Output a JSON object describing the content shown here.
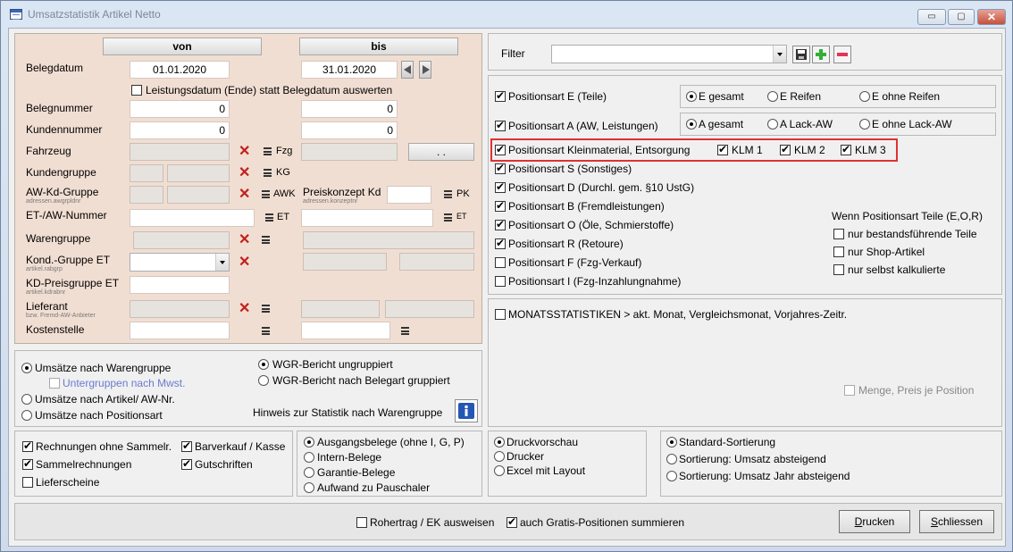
{
  "window": {
    "title": "Umsatzstatistik Artikel Netto",
    "controls": {
      "minimize": "▭",
      "maximize": "▢",
      "close": "✕"
    }
  },
  "criteria": {
    "col_von": "von",
    "col_bis": "bis",
    "belegdatum": {
      "label": "Belegdatum",
      "von": "01.01.2020",
      "bis": "31.01.2020"
    },
    "leistungsdatum_label": "Leistungsdatum (Ende) statt Belegdatum auswerten",
    "belegnummer": {
      "label": "Belegnummer",
      "von": "0",
      "bis": "0"
    },
    "kundennummer": {
      "label": "Kundennummer",
      "von": "0",
      "bis": "0"
    },
    "fahrzeug": {
      "label": "Fahrzeug",
      "tag": "Fzg",
      "button": ". ."
    },
    "kundengruppe": {
      "label": "Kundengruppe",
      "tag": "KG"
    },
    "aw_kd_gruppe": {
      "label": "AW-Kd-Gruppe",
      "sub": "adressen.awgrpldnr",
      "tag": "AWK"
    },
    "preiskonzept": {
      "label": "Preiskonzept Kd",
      "sub": "adressen.konzeptnr",
      "tag": "PK"
    },
    "et_aw_nummer": {
      "label": "ET-/AW-Nummer",
      "tag": "ET",
      "tag2": "ET"
    },
    "warengruppe": {
      "label": "Warengruppe"
    },
    "kond_gruppe": {
      "label": "Kond.-Gruppe ET",
      "sub": "artikel.rabgrp"
    },
    "kd_preisgruppe": {
      "label": "KD-Preisgruppe ET",
      "sub": "artikel.kdrabnr"
    },
    "lieferant": {
      "label": "Lieferant",
      "sub": "bzw. Fremd-AW-Anbieter"
    },
    "kostenstelle": {
      "label": "Kostenstelle"
    }
  },
  "filter": {
    "label": "Filter",
    "value": ""
  },
  "positions": {
    "e": {
      "label": "Positionsart E (Teile)",
      "checked": true
    },
    "e_opts": [
      "E gesamt",
      "E Reifen",
      "E ohne Reifen"
    ],
    "a": {
      "label": "Positionsart A (AW, Leistungen)",
      "checked": true
    },
    "a_opts": [
      "A gesamt",
      "A Lack-AW",
      "E ohne Lack-AW"
    ],
    "klein": {
      "label": "Positionsart Kleinmaterial, Entsorgung",
      "checked": true
    },
    "klm": [
      "KLM 1",
      "KLM 2",
      "KLM 3"
    ],
    "list": [
      {
        "label": "Positionsart S (Sonstiges)",
        "checked": true
      },
      {
        "label": "Positionsart D (Durchl. gem. §10 UstG)",
        "checked": true
      },
      {
        "label": "Positionsart B (Fremdleistungen)",
        "checked": true
      },
      {
        "label": "Positionsart O (Öle, Schmierstoffe)",
        "checked": true
      },
      {
        "label": "Positionsart R (Retoure)",
        "checked": true
      },
      {
        "label": "Positionsart F (Fzg-Verkauf)",
        "checked": false
      },
      {
        "label": "Positionsart I (Fzg-Inzahlungnahme)",
        "checked": false
      }
    ],
    "teile_head": "Wenn Positionsart Teile (E,O,R)",
    "teile_opts": [
      "nur bestandsführende Teile",
      "nur Shop-Artikel",
      "nur selbst kalkulierte"
    ]
  },
  "monat": {
    "label": "MONATSSTATISTIKEN > akt. Monat, Vergleichsmonat, Vorjahres-Zeitr.",
    "menge": "Menge, Preis je Position"
  },
  "umsatz": {
    "warengruppe": "Umsätze nach Warengruppe",
    "untergruppen": "Untergruppen nach Mwst.",
    "artikel": "Umsätze nach Artikel/ AW-Nr.",
    "positionsart": "Umsätze nach Positionsart",
    "wgr_ungrupp": "WGR-Bericht ungruppiert",
    "wgr_belegart": "WGR-Bericht nach Belegart gruppiert",
    "hinweis": "Hinweis zur Statistik nach Warengruppe"
  },
  "belegarten": {
    "rechnungen": "Rechnungen ohne Sammelr.",
    "barverkauf": "Barverkauf / Kasse",
    "sammel": "Sammelrechnungen",
    "gutschriften": "Gutschriften",
    "lieferscheine": "Lieferscheine"
  },
  "belegtyp": [
    "Ausgangsbelege (ohne I, G, P)",
    "Intern-Belege",
    "Garantie-Belege",
    "Aufwand zu Pauschaler"
  ],
  "ausgabe": [
    "Druckvorschau",
    "Drucker",
    "Excel mit Layout"
  ],
  "sortierung": [
    "Standard-Sortierung",
    "Sortierung: Umsatz absteigend",
    "Sortierung: Umsatz Jahr absteigend"
  ],
  "footer": {
    "rohertrag": "Rohertrag / EK ausweisen",
    "gratis": "auch Gratis-Positionen summieren",
    "drucken_u": "D",
    "drucken_rest": "rucken",
    "schliessen_u": "S",
    "schliessen_rest": "chliessen"
  },
  "colors": {
    "accent": "#e03131",
    "panel_tan": "#f1ded2",
    "x_red": "#c0211b"
  }
}
